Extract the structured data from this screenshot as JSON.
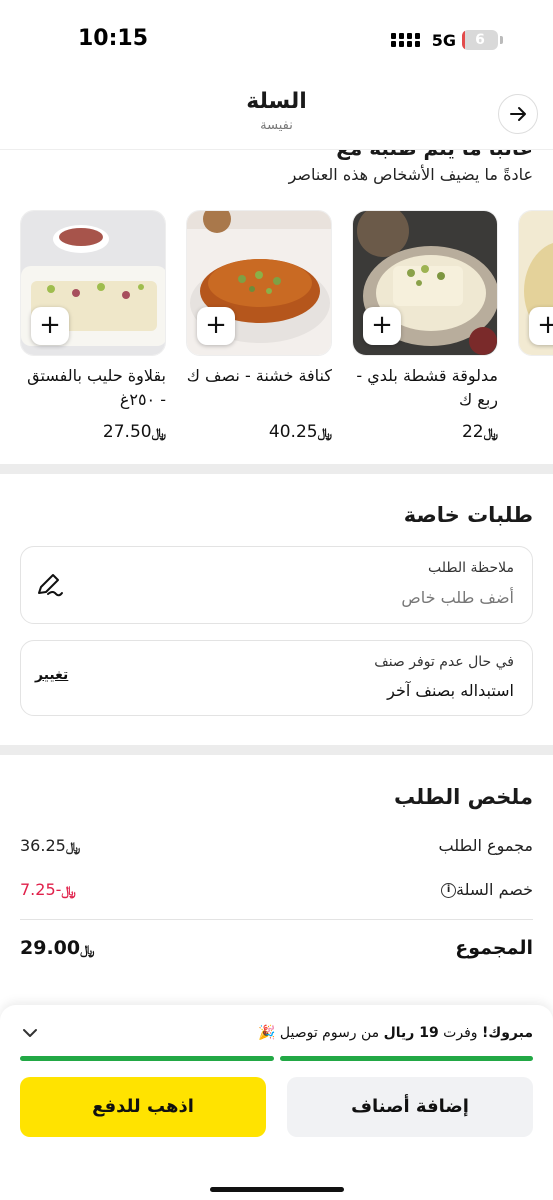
{
  "status_bar": {
    "time": "10:15",
    "network": "5G",
    "battery": "6"
  },
  "header": {
    "title": "السلة",
    "subtitle": "نفيسة"
  },
  "frequently_bought": {
    "title": "غالباً ما يتم طلبه مع",
    "subtitle": "عادةً ما يضيف الأشخاص هذه العناصر",
    "products": [
      {
        "name": "مدلوقة قشطة بلدي - ربع ك",
        "price": "22",
        "image": "madlouqa-photo"
      },
      {
        "name": "كنافة خشنة - نصف ك",
        "price": "40.25",
        "image": "knafeh-photo"
      },
      {
        "name": "بقلاوة حليب بالفستق - ٢٥٠غ",
        "price": "27.50",
        "image": "baklava-photo"
      }
    ],
    "add_label": "+",
    "currency_symbol": "﷼"
  },
  "special_requests": {
    "title": "طلبات خاصة",
    "note": {
      "label": "ملاحظة الطلب",
      "placeholder": "أضف طلب خاص"
    },
    "unavailable": {
      "label": "في حال عدم توفر صنف",
      "value": "استبداله بصنف آخر",
      "action": "تغيير"
    }
  },
  "summary": {
    "title": "ملخص الطلب",
    "subtotal_label": "مجموع الطلب",
    "subtotal": "36.25",
    "discount_label": "خصم السلة",
    "discount": "-7.25",
    "total_label": "المجموع",
    "total": "29.00",
    "colors": {
      "discount": "#e0204a"
    }
  },
  "footer": {
    "promo_bold": "مبروك!",
    "promo_text_1": "وفرت",
    "promo_bold_amount": "19 ريال",
    "promo_text_2": "من رسوم توصيل",
    "add_items_button": "إضافة أصناف",
    "checkout_button": "اذهب للدفع",
    "colors": {
      "checkout": "#ffe300",
      "progress": "#22a845"
    }
  }
}
